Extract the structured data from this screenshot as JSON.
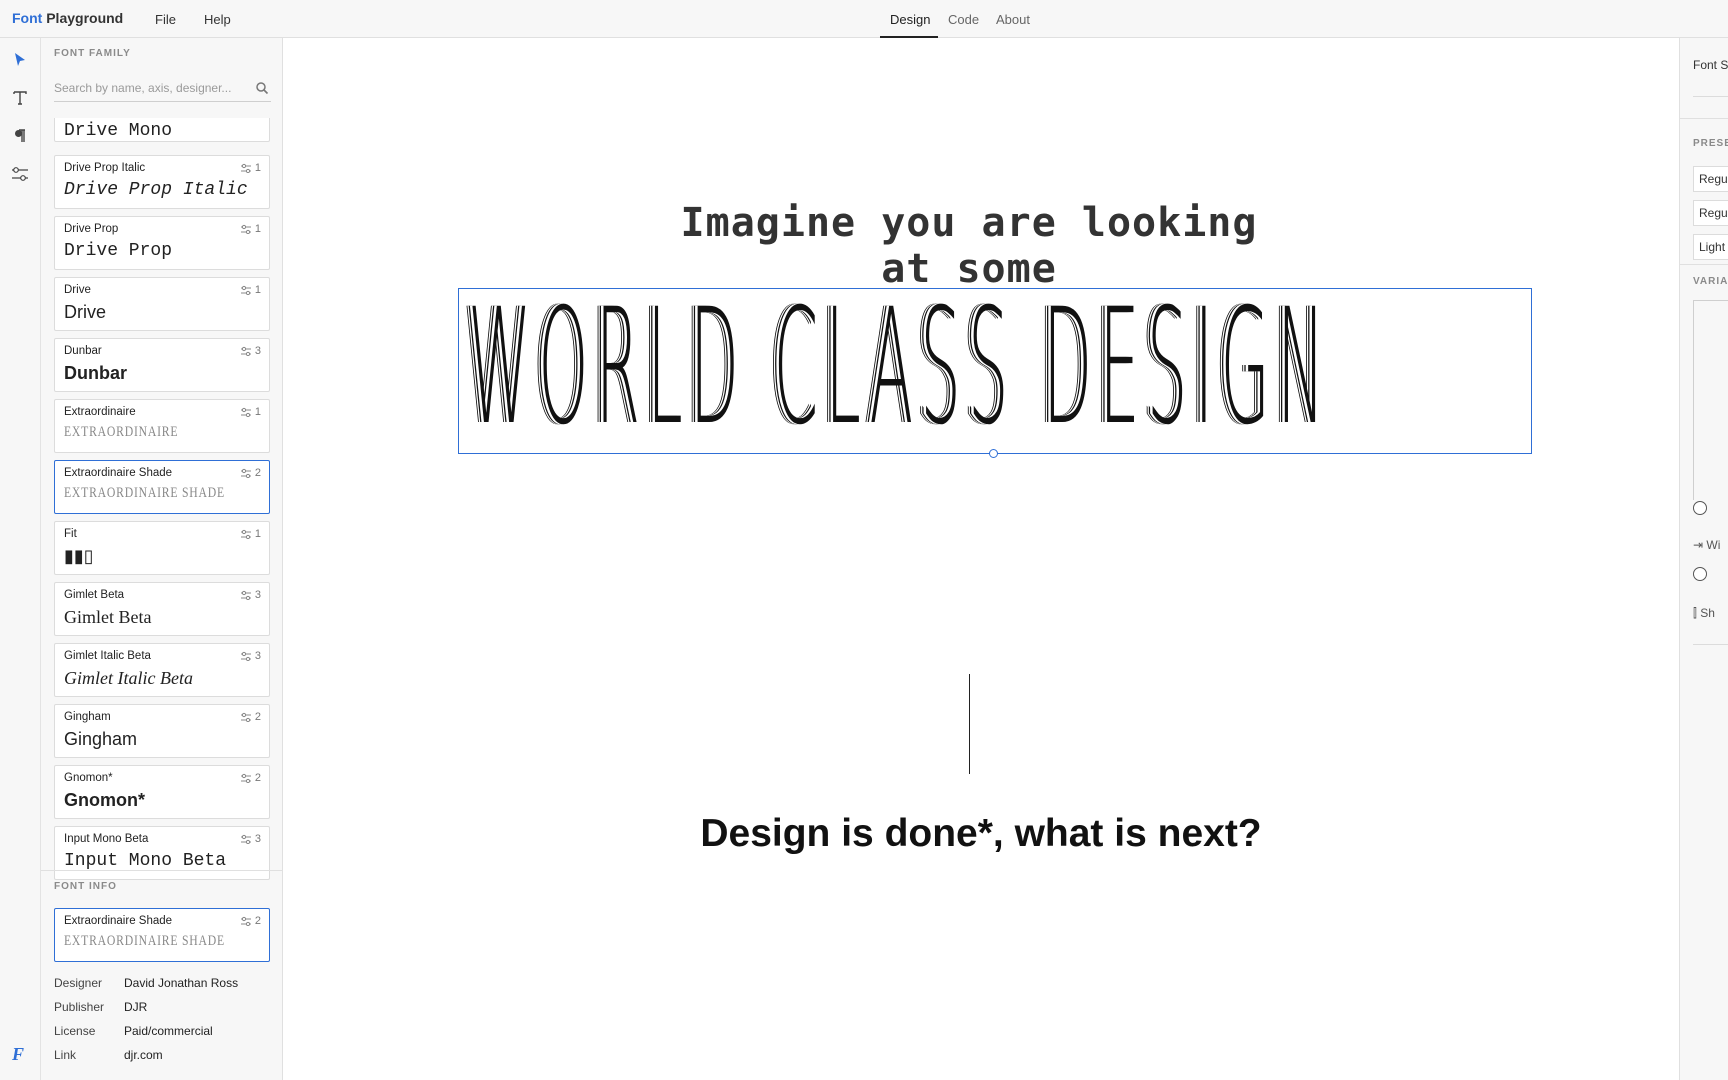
{
  "app": {
    "brand_accent": "Font",
    "brand_rest": "Playground"
  },
  "menu": {
    "file": "File",
    "help": "Help"
  },
  "tabs": {
    "design": "Design",
    "code": "Code",
    "about": "About",
    "active": "Design"
  },
  "sidebar": {
    "font_family_title": "FONT FAMILY",
    "search_placeholder": "Search by name, axis, designer...",
    "font_info_title": "FONT INFO",
    "fonts": [
      {
        "name": "",
        "axes": "",
        "sample": "Drive Mono",
        "style": "mono"
      },
      {
        "name": "Drive Prop Italic",
        "axes": "1",
        "sample": "Drive Prop Italic",
        "style": "mono italic"
      },
      {
        "name": "Drive Prop",
        "axes": "1",
        "sample": "Drive Prop",
        "style": "mono"
      },
      {
        "name": "Drive",
        "axes": "1",
        "sample": "Drive",
        "style": ""
      },
      {
        "name": "Dunbar",
        "axes": "3",
        "sample": "Dunbar",
        "style": "bold"
      },
      {
        "name": "Extraordinaire",
        "axes": "1",
        "sample": "EXTRAORDINAIRE",
        "style": "deco"
      },
      {
        "name": "Extraordinaire Shade",
        "axes": "2",
        "sample": "EXTRAORDINAIRE SHADE",
        "style": "deco",
        "selected": true
      },
      {
        "name": "Fit",
        "axes": "1",
        "sample": "▮▮▯",
        "style": "bold"
      },
      {
        "name": "Gimlet Beta",
        "axes": "3",
        "sample": "Gimlet Beta",
        "style": "serif"
      },
      {
        "name": "Gimlet Italic Beta",
        "axes": "3",
        "sample": "Gimlet Italic Beta",
        "style": "serif italic"
      },
      {
        "name": "Gingham",
        "axes": "2",
        "sample": "Gingham",
        "style": ""
      },
      {
        "name": "Gnomon*",
        "axes": "2",
        "sample": "Gnomon*",
        "style": "bold"
      },
      {
        "name": "Input Mono Beta",
        "axes": "3",
        "sample": "Input Mono Beta",
        "style": "mono"
      }
    ],
    "info": {
      "card_name": "Extraordinaire Shade",
      "card_axes": "2",
      "card_sample": "EXTRAORDINAIRE SHADE",
      "designer_label": "Designer",
      "designer": "David Jonathan Ross",
      "publisher_label": "Publisher",
      "publisher": "DJR",
      "license_label": "License",
      "license": "Paid/commercial",
      "link_label": "Link",
      "link": "djr.com"
    }
  },
  "canvas": {
    "line1": "Imagine you are looking at some",
    "line2": "WORLD CLASS DESIGN",
    "line3": "Design is done*, what is next?"
  },
  "rightpanel": {
    "font_size_label": "Font S",
    "presets_title": "PRESE",
    "presets": [
      "Regul",
      "Regul",
      "Light"
    ],
    "variations_title": "VARIA",
    "axis1_label": "Wi",
    "axis2_label": "Sh"
  },
  "colors": {
    "accent": "#2f6fd6",
    "selection": "#2f6fd6"
  }
}
